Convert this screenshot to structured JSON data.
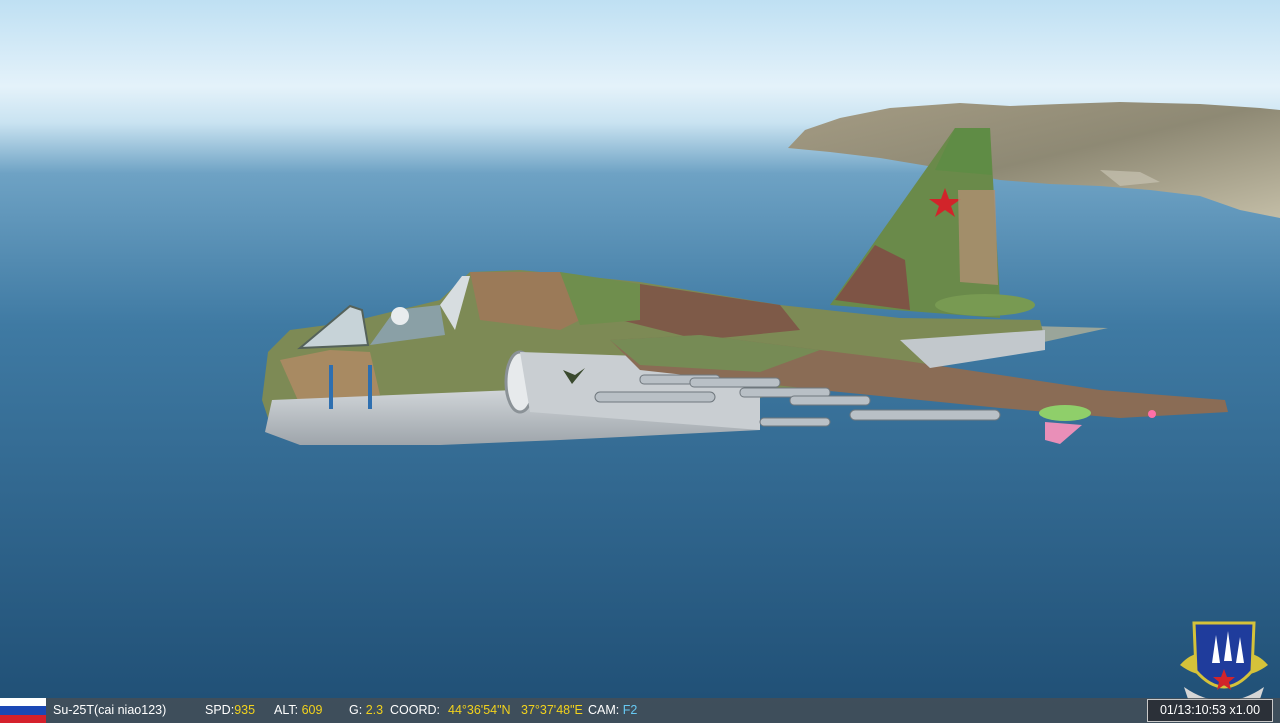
{
  "hud": {
    "aircraft": "Su-25T(cai niao123)",
    "spd_label": "SPD:",
    "spd_value": "935",
    "alt_label": "ALT:",
    "alt_value": "609",
    "g_label": "G:",
    "g_value": "2.3",
    "coord_label": "COORD:",
    "lat": "44°36'54\"N",
    "lon": "37°37'48\"E",
    "cam_label": "CAM:",
    "cam_value": "F2",
    "time": "01/13:10:53  x1.00"
  },
  "colors": {
    "flag": [
      "#ffffff",
      "#1b48b5",
      "#d5202c"
    ],
    "value_yellow": "#f2d21c",
    "value_cyan": "#66c8f2",
    "sky_top": "#d9edf8",
    "sea_deep": "#1f4e74"
  },
  "scene": {
    "aircraft_icon": "su-25t-attack-jet",
    "roundel": "red-star-icon",
    "emblem": "squadron-emblem-icon"
  }
}
